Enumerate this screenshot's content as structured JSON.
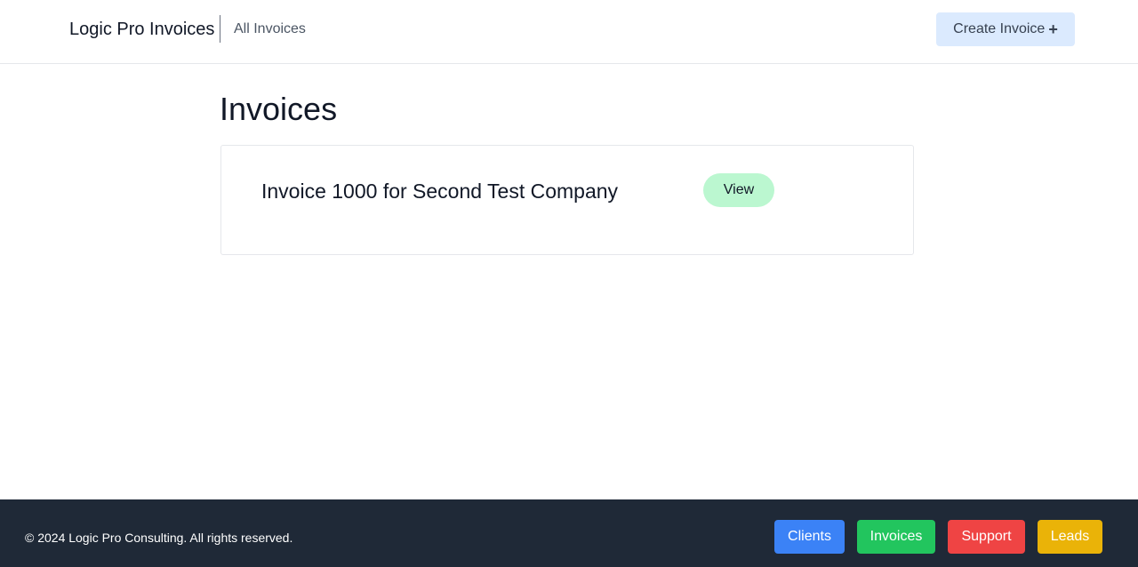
{
  "header": {
    "brand": "Logic Pro Invoices",
    "nav_link": "All Invoices",
    "create_button_label": "Create Invoice",
    "create_button_icon": "+"
  },
  "main": {
    "title": "Invoices",
    "invoices": [
      {
        "title": "Invoice 1000 for Second Test Company",
        "view_label": "View"
      }
    ]
  },
  "footer": {
    "copyright": "© 2024 Logic Pro Consulting. All rights reserved.",
    "buttons": [
      {
        "label": "Clients",
        "color": "#3b82f6"
      },
      {
        "label": "Invoices",
        "color": "#22c55e"
      },
      {
        "label": "Support",
        "color": "#ef4444"
      },
      {
        "label": "Leads",
        "color": "#eab308"
      }
    ]
  },
  "colors": {
    "footer_bg": "#1f2937",
    "create_button_bg": "#dbeafe",
    "view_button_bg": "#bbf7d0"
  }
}
